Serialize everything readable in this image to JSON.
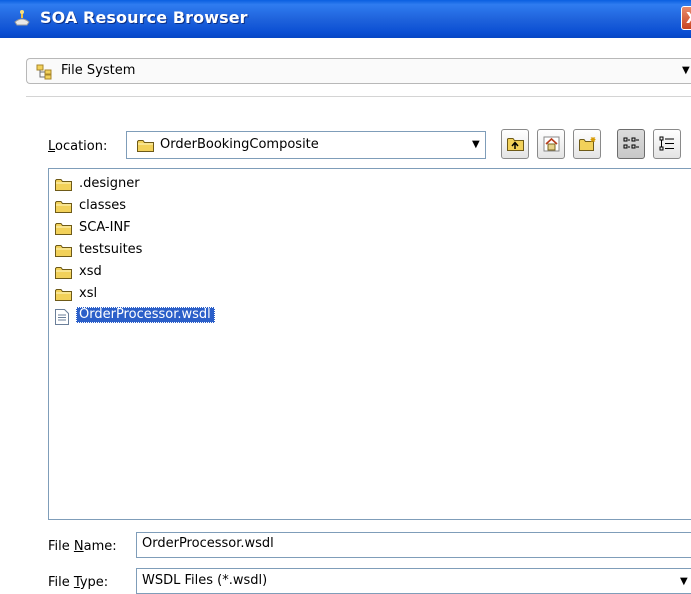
{
  "window": {
    "title": "SOA Resource Browser",
    "close_glyph": "X"
  },
  "source": {
    "selected": "File System",
    "icon": "file-system-icon"
  },
  "location": {
    "label_prefix": "",
    "label_mnemonic": "L",
    "label_rest": "ocation:",
    "value": "OrderBookingComposite"
  },
  "toolbar": {
    "buttons": [
      "up-one-level-icon",
      "home-icon",
      "new-folder-icon",
      "list-view-icon",
      "details-view-icon"
    ]
  },
  "files": [
    {
      "name": ".designer",
      "type": "folder"
    },
    {
      "name": "classes",
      "type": "folder"
    },
    {
      "name": "SCA-INF",
      "type": "folder"
    },
    {
      "name": "testsuites",
      "type": "folder"
    },
    {
      "name": "xsd",
      "type": "folder"
    },
    {
      "name": "xsl",
      "type": "folder"
    },
    {
      "name": "OrderProcessor.wsdl",
      "type": "file",
      "selected": true
    }
  ],
  "file_name": {
    "label_prefix": "File ",
    "label_mnemonic": "N",
    "label_rest": "ame:",
    "value": "OrderProcessor.wsdl"
  },
  "file_type": {
    "label_prefix": "File ",
    "label_mnemonic": "T",
    "label_rest": "ype:",
    "value": "WSDL Files (*.wsdl)"
  },
  "colors": {
    "title_bar": "#1f63dc",
    "selection": "#2b5fc9",
    "folder": "#f2d15a"
  }
}
